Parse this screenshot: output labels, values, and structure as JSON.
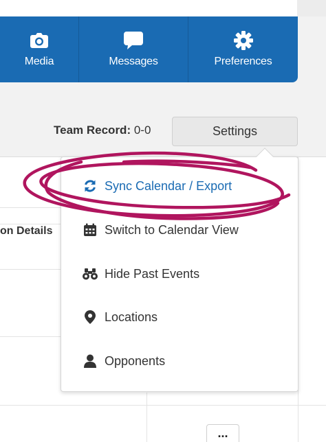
{
  "nav": {
    "items": [
      {
        "label": "Media",
        "icon": "camera-icon"
      },
      {
        "label": "Messages",
        "icon": "chat-bubble-icon"
      },
      {
        "label": "Preferences",
        "icon": "gear-icon"
      }
    ],
    "color": "#1a6bb3"
  },
  "team_record": {
    "label": "Team Record:",
    "value": "0-0"
  },
  "settings_button": {
    "label": "Settings"
  },
  "table": {
    "column_header": "on Details",
    "more_label": "..."
  },
  "dropdown": {
    "items": [
      {
        "label": "Sync Calendar / Export",
        "icon": "sync-icon",
        "active": true
      },
      {
        "label": "Switch to Calendar View",
        "icon": "calendar-icon"
      },
      {
        "label": "Hide Past Events",
        "icon": "binoculars-icon"
      },
      {
        "label": "Locations",
        "icon": "map-pin-icon"
      },
      {
        "label": "Opponents",
        "icon": "user-icon"
      }
    ]
  },
  "annotation": {
    "color": "#b0155e",
    "shape": "hand-drawn-circle"
  }
}
